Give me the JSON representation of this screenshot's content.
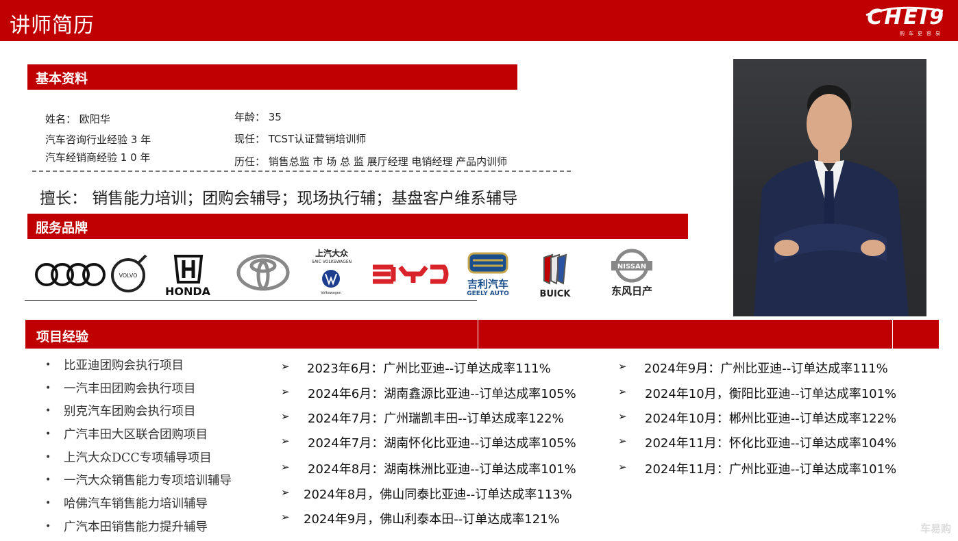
{
  "header": {
    "title": "讲师简历",
    "logo_text": "CHEI9",
    "logo_sub": "购车更容易"
  },
  "basic": {
    "section_label": "基本资料",
    "name": "姓名：  欧阳华",
    "age": "年龄：  35",
    "consult_exp": "汽车咨询行业经验 3 年",
    "current": "现任：   TCST认证营销培训师",
    "dealer_exp": "汽车经销商经验 1 0 年",
    "history": "历任：  销售总监    市 场 总 监     展厅经理   电销经理   产品内训师",
    "skills": "擅长：  销售能力培训；团购会辅导；现场执行辅；基盘客户维系辅导"
  },
  "brand_section": {
    "section_label": "服务品牌",
    "honda": "HONDA",
    "svw_cn": "上汽大众",
    "svw_en": "SAIC VOLKSWAGEN",
    "vw_small": "Volkswagen",
    "byd": "BYD",
    "geely_cn": "吉利汽车",
    "geely_en": "GEELY AUTO",
    "buick": "BUICK",
    "nissan": "NISSAN",
    "dfn_cn": "东风日产"
  },
  "projects": {
    "section_label": "项目经验",
    "items": [
      "比亚迪团购会执行项目",
      "一汽丰田团购会执行项目",
      "别克汽车团购会执行项目",
      "广汽丰田大区联合团购项目",
      "上汽大众DCC专项辅导项目",
      "一汽大众销售能力专项培训辅导",
      "哈佛汽车销售能力培训辅导",
      "广汽本田销售能力提升辅导"
    ],
    "results_col1": [
      "2023年6月：广州比亚迪--订单达成率111%",
      "2024年6月：湖南鑫源比亚迪--订单达成率105%",
      "2024年7月：广州瑞凯丰田--订单达成率122%",
      "2024年7月：湖南怀化比亚迪--订单达成率105%",
      "2024年8月：湖南株洲比亚迪--订单达成率101%",
      "2024年8月，佛山同泰比亚迪--订单达成率113%",
      "2024年9月，佛山利泰本田--订单达成率121%"
    ],
    "results_col2": [
      "2024年9月：广州比亚迪--订单达成率111%",
      "2024年10月，衡阳比亚迪--订单达成率101%",
      "2024年10月：郴州比亚迪--订单达成率122%",
      "2024年11月：怀化比亚迪--订单达成率104%",
      "2024年11月：广州比亚迪--订单达成率101%"
    ]
  },
  "watermark": "车易购",
  "colors": {
    "accent": "#c00000"
  }
}
